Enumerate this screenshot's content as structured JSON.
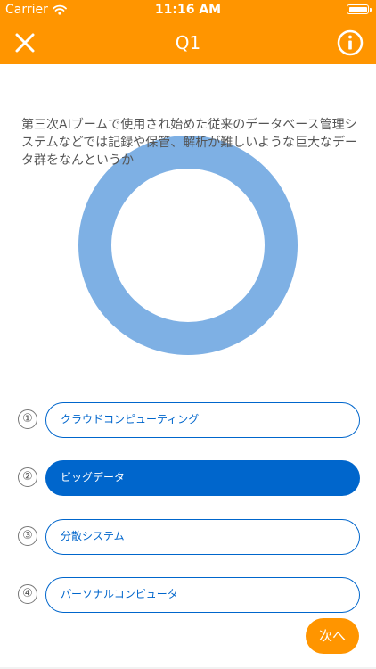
{
  "status_bar": {
    "carrier": "Carrier",
    "time": "11:16 AM"
  },
  "nav": {
    "title": "Q1",
    "close_icon": "close-icon",
    "info_icon": "info-icon"
  },
  "question": {
    "text": "第三次AIブームで使用され始めた従来のデータベース管理システムなどでは記録や保管、解析が難しいような巨大なデータ群をなんというか"
  },
  "choices": [
    {
      "number": "①",
      "label": "クラウドコンピューティング",
      "selected": false
    },
    {
      "number": "②",
      "label": "ビッグデータ",
      "selected": true
    },
    {
      "number": "③",
      "label": "分散システム",
      "selected": false
    },
    {
      "number": "④",
      "label": "パーソナルコンピュータ",
      "selected": false
    }
  ],
  "next_button": {
    "label": "次へ"
  },
  "colors": {
    "accent": "#FF9500",
    "choice": "#0066CC",
    "ring": "#7EB0E4"
  }
}
